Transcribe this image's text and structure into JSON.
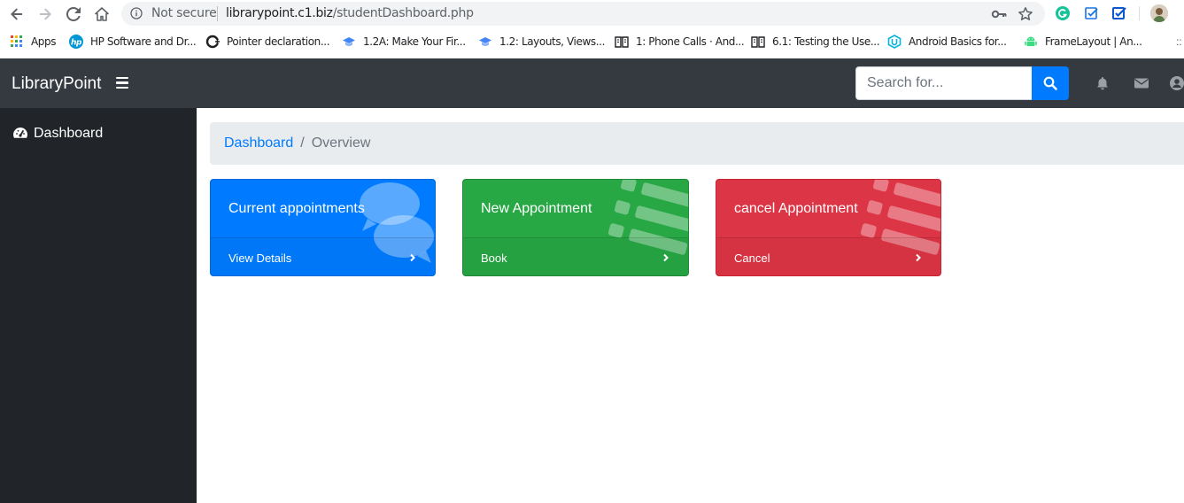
{
  "browser": {
    "security_label": "Not secure",
    "url_host": "librarypoint.c1.biz",
    "url_path": "/studentDashboard.php",
    "bookmarks": [
      {
        "label": "Apps",
        "icon": "apps-grid-icon"
      },
      {
        "label": "HP Software and Dr...",
        "icon": "hp-logo-icon"
      },
      {
        "label": "Pointer declaration...",
        "icon": "cpp-reference-icon"
      },
      {
        "label": "1.2A: Make Your Fir...",
        "icon": "graduation-cap-icon"
      },
      {
        "label": "1.2: Layouts, Views...",
        "icon": "graduation-cap-icon"
      },
      {
        "label": "1: Phone Calls · And...",
        "icon": "book-icon"
      },
      {
        "label": "6.1: Testing the Use...",
        "icon": "book-icon"
      },
      {
        "label": "Android Basics for...",
        "icon": "udacity-icon"
      },
      {
        "label": "FrameLayout  |  An...",
        "icon": "android-icon"
      }
    ],
    "bookmarks_overflow": "::"
  },
  "navbar": {
    "brand": "LibraryPoint",
    "search_placeholder": "Search for..."
  },
  "sidebar": {
    "items": [
      {
        "label": "Dashboard",
        "icon": "tachometer-icon"
      }
    ]
  },
  "breadcrumb": {
    "link": "Dashboard",
    "separator": "/",
    "active": "Overview"
  },
  "cards": [
    {
      "title": "Current appointments",
      "footer": "View Details",
      "color": "#007bff",
      "icon": "comments-icon"
    },
    {
      "title": "New Appointment",
      "footer": "Book",
      "color": "#28a745",
      "icon": "list-icon"
    },
    {
      "title": "cancel Appointment",
      "footer": "Cancel",
      "color": "#dc3545",
      "icon": "list-icon"
    }
  ],
  "colors": {
    "navbar_bg": "#343a40",
    "sidebar_bg": "#212529",
    "primary": "#007bff",
    "success": "#28a745",
    "danger": "#dc3545",
    "breadcrumb_bg": "#e9ecef"
  }
}
